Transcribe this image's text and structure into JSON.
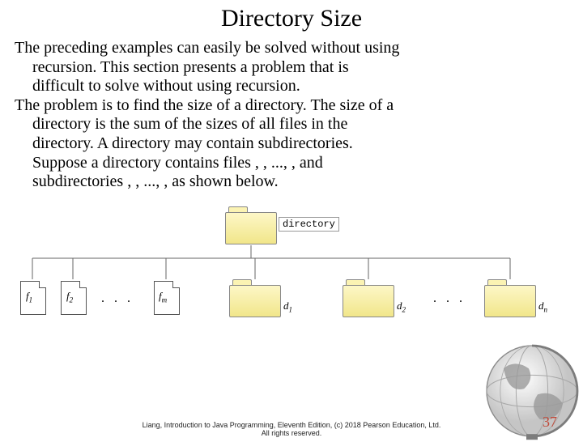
{
  "title": "Directory Size",
  "paragraphs": {
    "p1a": "The preceding examples can easily be solved without using",
    "p1b": "recursion.  This section presents a problem that is",
    "p1c": "difficult to solve without using recursion.",
    "p2a": "The problem is to find the size of a directory. The size of a",
    "p2b": "directory is the sum of the sizes of all files in the",
    "p2c": "directory. A directory  may contain subdirectories.",
    "p2d": "Suppose a directory contains files , , ..., , and",
    "p2e": "subdirectories , , ..., , as shown below."
  },
  "diagram": {
    "root_label": "directory",
    "files": [
      "f",
      "f",
      "f"
    ],
    "file_subs": [
      "1",
      "2",
      "m"
    ],
    "dirs": [
      "d",
      "d",
      "d"
    ],
    "dir_subs": [
      "1",
      "2",
      "n"
    ],
    "dots": ". . ."
  },
  "footer_line1": "Liang, Introduction to Java Programming, Eleventh Edition, (c) 2018 Pearson Education, Ltd.",
  "footer_line2": "All rights reserved.",
  "page_number": "37"
}
